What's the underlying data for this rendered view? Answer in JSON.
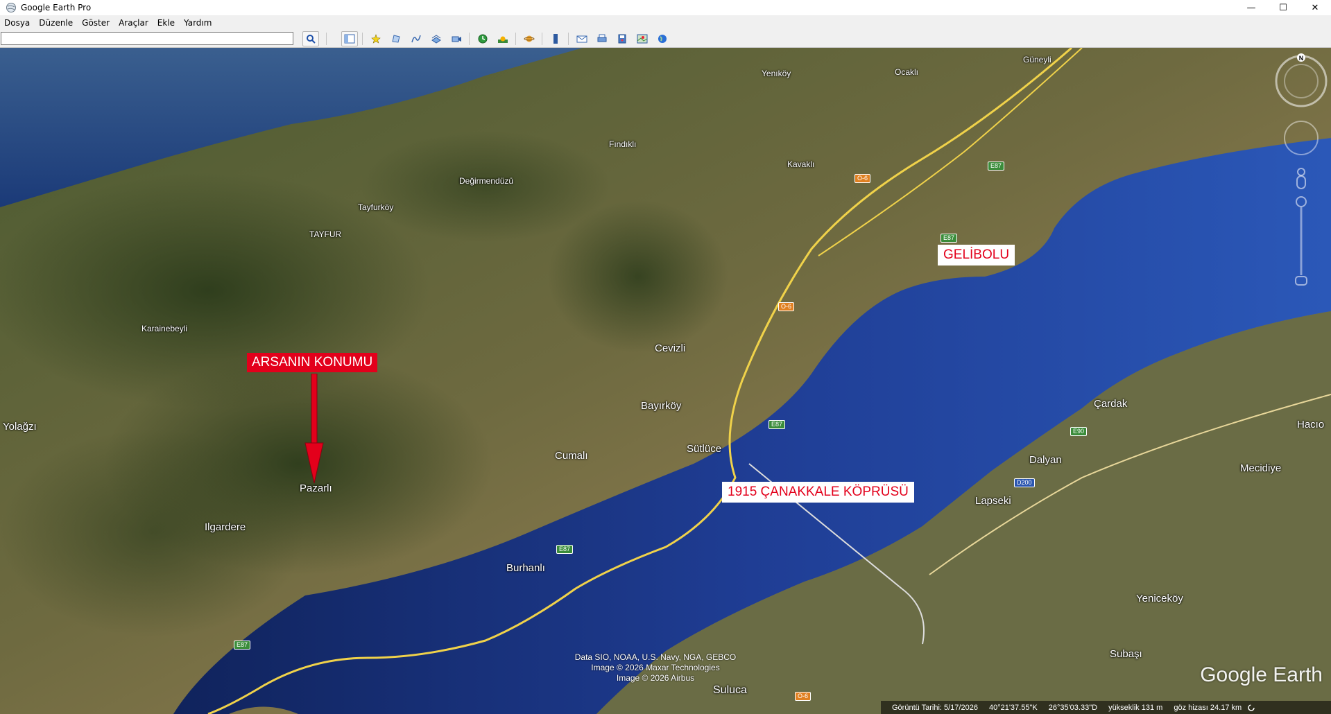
{
  "window": {
    "title": "Google Earth Pro",
    "controls": {
      "minimize": "—",
      "maximize": "☐",
      "close": "✕"
    }
  },
  "menu": [
    "Dosya",
    "Düzenle",
    "Göster",
    "Araçlar",
    "Ekle",
    "Yardım"
  ],
  "search": {
    "value": "",
    "placeholder": ""
  },
  "toolbar": {
    "icons": [
      "search-icon",
      "sidebar-icon",
      "placemark-icon",
      "polygon-icon",
      "path-icon",
      "image-overlay-icon",
      "record-tour-icon",
      "historical-imagery-icon",
      "sunlight-icon",
      "planets-icon",
      "ruler-icon",
      "email-icon",
      "print-icon",
      "save-image-icon",
      "view-in-maps-icon",
      "earth-icon"
    ]
  },
  "map": {
    "places": [
      {
        "name": "Güneyli"
      },
      {
        "name": "Yenıköy"
      },
      {
        "name": "Ocaklı"
      },
      {
        "name": "Fındıklı"
      },
      {
        "name": "Kavaklı"
      },
      {
        "name": "Değirmendüzü"
      },
      {
        "name": "Tayfurköy"
      },
      {
        "name": "TAYFUR"
      },
      {
        "name": "Karainebeyli"
      },
      {
        "name": "Cevizli"
      },
      {
        "name": "Bayırköy"
      },
      {
        "name": "Yolağzı"
      },
      {
        "name": "Cumalı"
      },
      {
        "name": "Sütlüce"
      },
      {
        "name": "Pazarlı"
      },
      {
        "name": "Ilgardere"
      },
      {
        "name": "Burhanlı"
      },
      {
        "name": "Çardak"
      },
      {
        "name": "Hacıo"
      },
      {
        "name": "Dalyan"
      },
      {
        "name": "Mecidiye"
      },
      {
        "name": "Lapseki"
      },
      {
        "name": "Yeniceköy"
      },
      {
        "name": "Subaşı"
      },
      {
        "name": "Suluca"
      }
    ],
    "road_shields": [
      "E87",
      "O-6",
      "E87",
      "O-6",
      "E87",
      "E87",
      "E87",
      "E90",
      "D200",
      "O-6"
    ],
    "annotations": {
      "gelibolu": "GELİBOLU",
      "bridge": "1915 ÇANAKKALE KÖPRÜSÜ",
      "plot": "ARSANIN KONUMU"
    },
    "attribution": [
      "Data SIO, NOAA, U.S. Navy, NGA, GEBCO",
      "Image © 2026 Maxar Technologies",
      "Image © 2026 Airbus"
    ],
    "logo": "Google Earth",
    "north_label": "N",
    "colors": {
      "sea": "#1e3f8f",
      "land": "#5c6a3a",
      "annotation_red": "#e3001b",
      "highway": "#f0d24a"
    }
  },
  "status": {
    "imagery_date": "Görüntü Tarihi: 5/17/2026",
    "latitude": "40°21'37.55\"K",
    "longitude": "26°35'03.33\"D",
    "elevation": "yükseklik    131 m",
    "eye_alt": "göz hizası  24.17 km"
  }
}
